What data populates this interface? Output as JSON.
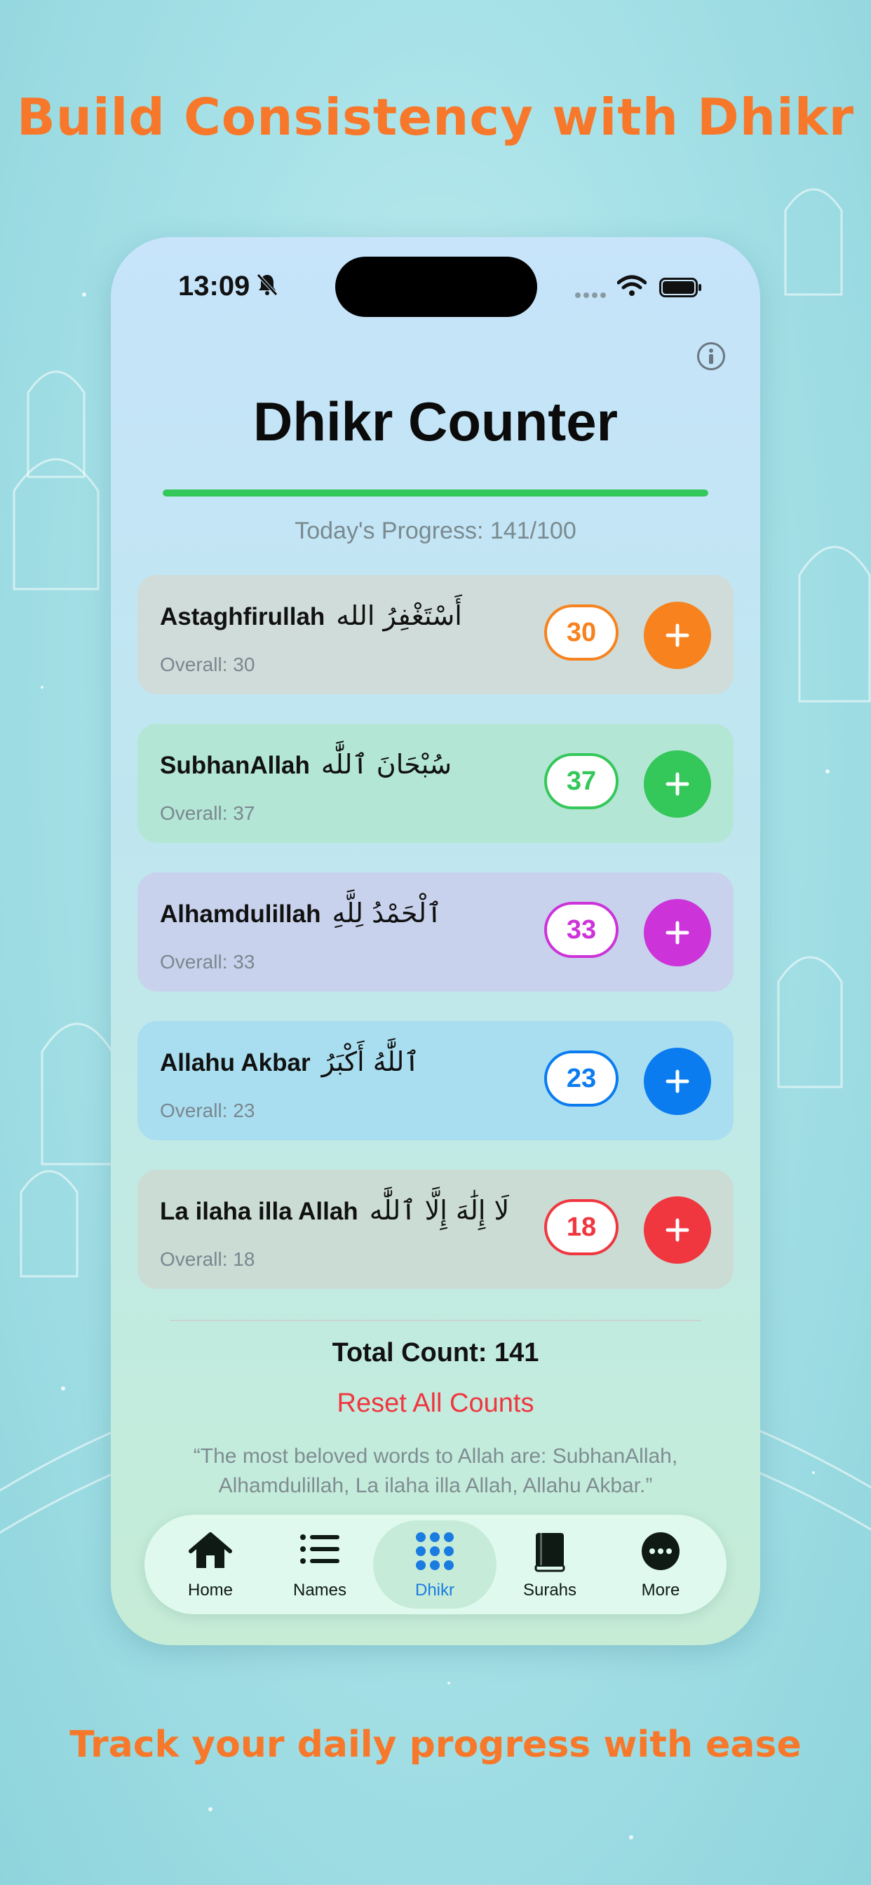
{
  "promo": {
    "headline": "Build Consistency with Dhikr",
    "footline": "Track your daily progress with ease"
  },
  "status_bar": {
    "time": "13:09"
  },
  "screen": {
    "title": "Dhikr Counter",
    "progress_label": "Today's Progress: 141/100",
    "progress_fraction": 1.0
  },
  "dhikr_items": [
    {
      "name": "Astaghfirullah",
      "arabic": "أَسْتَغْفِرُ الله",
      "overall": "Overall: 30",
      "count": "30",
      "color": "#f7821e",
      "card_bg": "#cfdcd9"
    },
    {
      "name": "SubhanAllah",
      "arabic": "سُبْحَانَ ٱللَّٰه",
      "overall": "Overall: 37",
      "count": "37",
      "color": "#34c759",
      "card_bg": "#b3e6d4"
    },
    {
      "name": "Alhamdulillah",
      "arabic": "ٱلْحَمْدُ لِلَّهِ",
      "overall": "Overall: 33",
      "count": "33",
      "color": "#cc33d9",
      "card_bg": "#c8d2ec"
    },
    {
      "name": "Allahu Akbar",
      "arabic": "ٱللَّٰهُ أَكْبَرُ",
      "overall": "Overall: 23",
      "count": "23",
      "color": "#0a7cf0",
      "card_bg": "#a9def0"
    },
    {
      "name": "La ilaha illa Allah",
      "arabic": "لَا إِلَٰهَ إِلَّا ٱللَّٰه",
      "overall": "Overall: 18",
      "count": "18",
      "color": "#f0363f",
      "card_bg": "#cadcd4"
    }
  ],
  "summary": {
    "total": "Total Count: 141",
    "reset_label": "Reset All Counts",
    "quote": "“The most beloved words to Allah are: SubhanAllah, Alhamdulillah, La ilaha illa Allah, Allahu Akbar.”"
  },
  "tabbar": {
    "tabs": [
      {
        "label": "Home",
        "icon": "house-icon"
      },
      {
        "label": "Names",
        "icon": "list-icon"
      },
      {
        "label": "Dhikr",
        "icon": "grid-dots-icon",
        "active": true
      },
      {
        "label": "Surahs",
        "icon": "book-icon"
      },
      {
        "label": "More",
        "icon": "ellipsis-circle-icon"
      }
    ]
  },
  "colors": {
    "accent_orange": "#f7782a",
    "active_tab": "#1a7be0",
    "progress": "#34c759",
    "reset": "#f0363f"
  }
}
